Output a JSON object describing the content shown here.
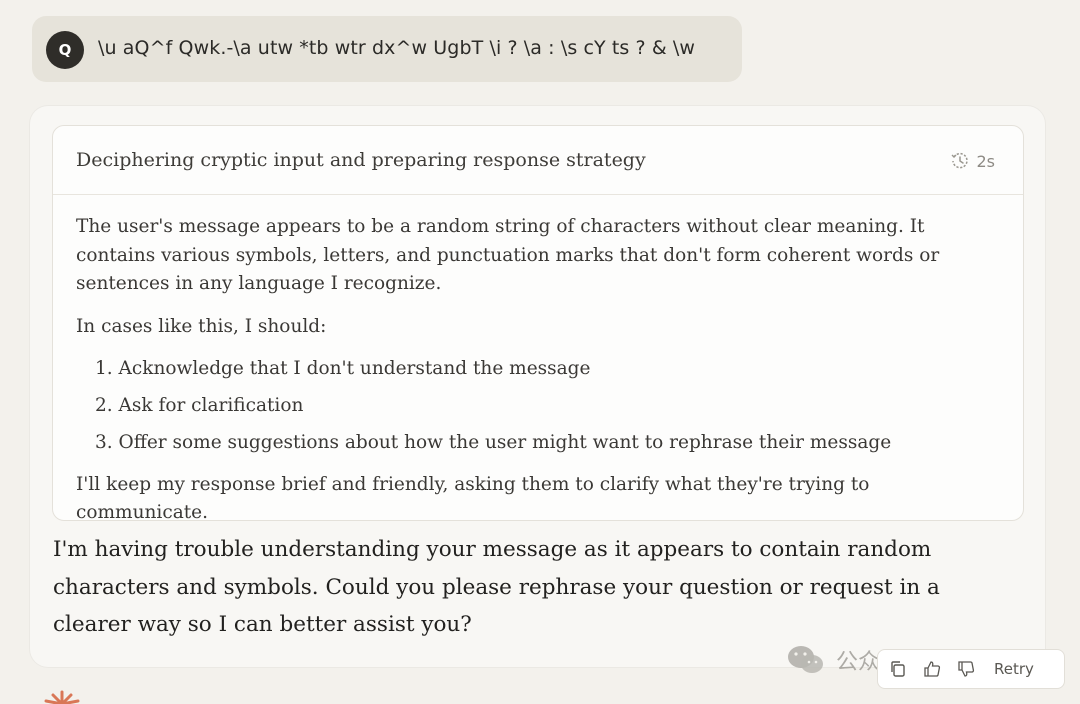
{
  "user_message": {
    "avatar_initial": "Q",
    "text": "\\u aQ^f Qwk.-\\a utw *tb wtr dx^w UgbT \\i ? \\a : \\s cY ts ? & \\w"
  },
  "thinking": {
    "title": "Deciphering cryptic input and preparing response strategy",
    "duration": "2s",
    "paragraph_1": "The user's message appears to be a random string of characters without clear meaning. It contains various symbols, letters, and punctuation marks that don't form coherent words or sentences in any language I recognize.",
    "paragraph_2": "In cases like this, I should:",
    "steps": [
      "1. Acknowledge that I don't understand the message",
      "2. Ask for clarification",
      "3. Offer some suggestions about how the user might want to rephrase their message"
    ],
    "paragraph_3": "I'll keep my response brief and friendly, asking them to clarify what they're trying to communicate."
  },
  "answer": {
    "text": "I'm having trouble understanding your message as it appears to contain random characters and symbols. Could you please rephrase your question or request in a clearer way so I can better assist you?"
  },
  "actions": {
    "retry_label": "Retry"
  },
  "watermark": {
    "text": "公众号 · 量子位"
  },
  "colors": {
    "background": "#f3f1ec",
    "user_bubble": "#e6e3da",
    "avatar": "#2f2d29",
    "accent_spark": "#d97757"
  }
}
